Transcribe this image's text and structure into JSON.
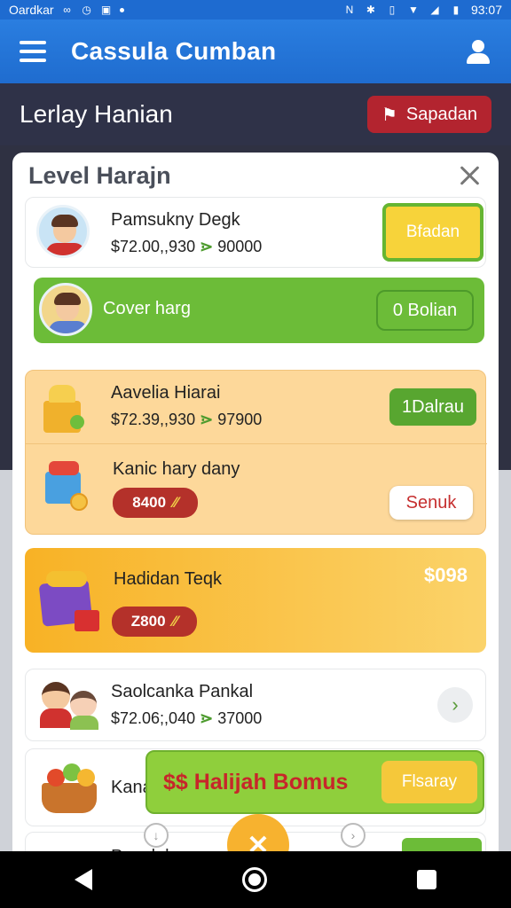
{
  "status_bar": {
    "carrier": "Oardkar",
    "time": "93:07"
  },
  "app_bar": {
    "title": "Cassula Cumban"
  },
  "sub_header": {
    "title": "Lerlay Hanian",
    "button_label": "Sapadan"
  },
  "modal": {
    "title": "Level Harajn",
    "items": [
      {
        "name": "Pamsukny Degk",
        "meta": "$72.00,,930",
        "meta2": "90000",
        "button": "Bfadan"
      },
      {
        "name": "Cover harg",
        "button": "0 Bolian"
      },
      {
        "name": "Aavelia Hiarai",
        "meta": "$72.39,,930",
        "meta2": "97900",
        "button": "1Dalrau"
      },
      {
        "name": "Kanic hary dany",
        "pill": "8400",
        "button": "Senuk"
      },
      {
        "name": "Hadidan Teqk",
        "pill": "Z800",
        "price": "$098"
      },
      {
        "name": "Saolcanka Pankal",
        "meta": "$72.06;,040",
        "meta2": "37000"
      },
      {
        "name": "Kana",
        "bonus_text": "$$ Halijah Bomus",
        "button": "Flsaray"
      },
      {
        "name": "Panslnkam"
      }
    ]
  },
  "colors": {
    "primary": "#1f6ccf",
    "accent_green": "#6cbc38",
    "accent_orange": "#f7b22f",
    "accent_red": "#b4312a"
  },
  "icons": [
    "menu-icon",
    "user-icon",
    "flag-icon",
    "close-icon",
    "arrow-icon",
    "chevron-right-icon",
    "back-icon",
    "home-icon",
    "recent-icon"
  ]
}
